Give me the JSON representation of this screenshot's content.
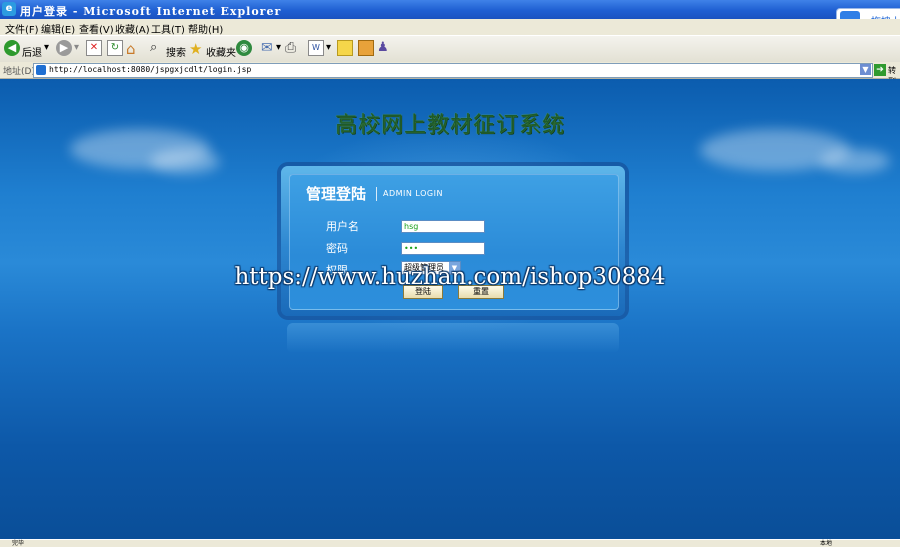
{
  "window": {
    "title": "用户登录 - Microsoft Internet Explorer"
  },
  "cloud_badge": {
    "label": "拖拽上"
  },
  "menu": [
    "文件(F)",
    "编辑(E)",
    "查看(V)",
    "收藏(A)",
    "工具(T)",
    "帮助(H)"
  ],
  "toolbar": {
    "back_label": "后退",
    "search_label": "搜索",
    "favorites_label": "收藏夹"
  },
  "address": {
    "label": "地址(D)",
    "url": "http://localhost:8080/jspgxjcdlt/login.jsp",
    "go_label": "转到"
  },
  "page": {
    "system_title": "高校网上教材征订系统",
    "panel_title": "管理登陆",
    "panel_subtitle": "ADMIN LOGIN",
    "username_label": "用户名",
    "username_value": "hsg",
    "password_label": "密码",
    "password_value": "•••",
    "role_label": "权限",
    "role_value": "超级管理员",
    "login_button": "登陆",
    "reset_button": "重置"
  },
  "watermark": "https://www.huzhan.com/ishop30884",
  "status": {
    "left": "完毕",
    "right": "本地"
  },
  "colors": {
    "titlebar": "#1f5fd2",
    "page_background": "#1f7fd0",
    "system_title": "#1c5a2c"
  }
}
